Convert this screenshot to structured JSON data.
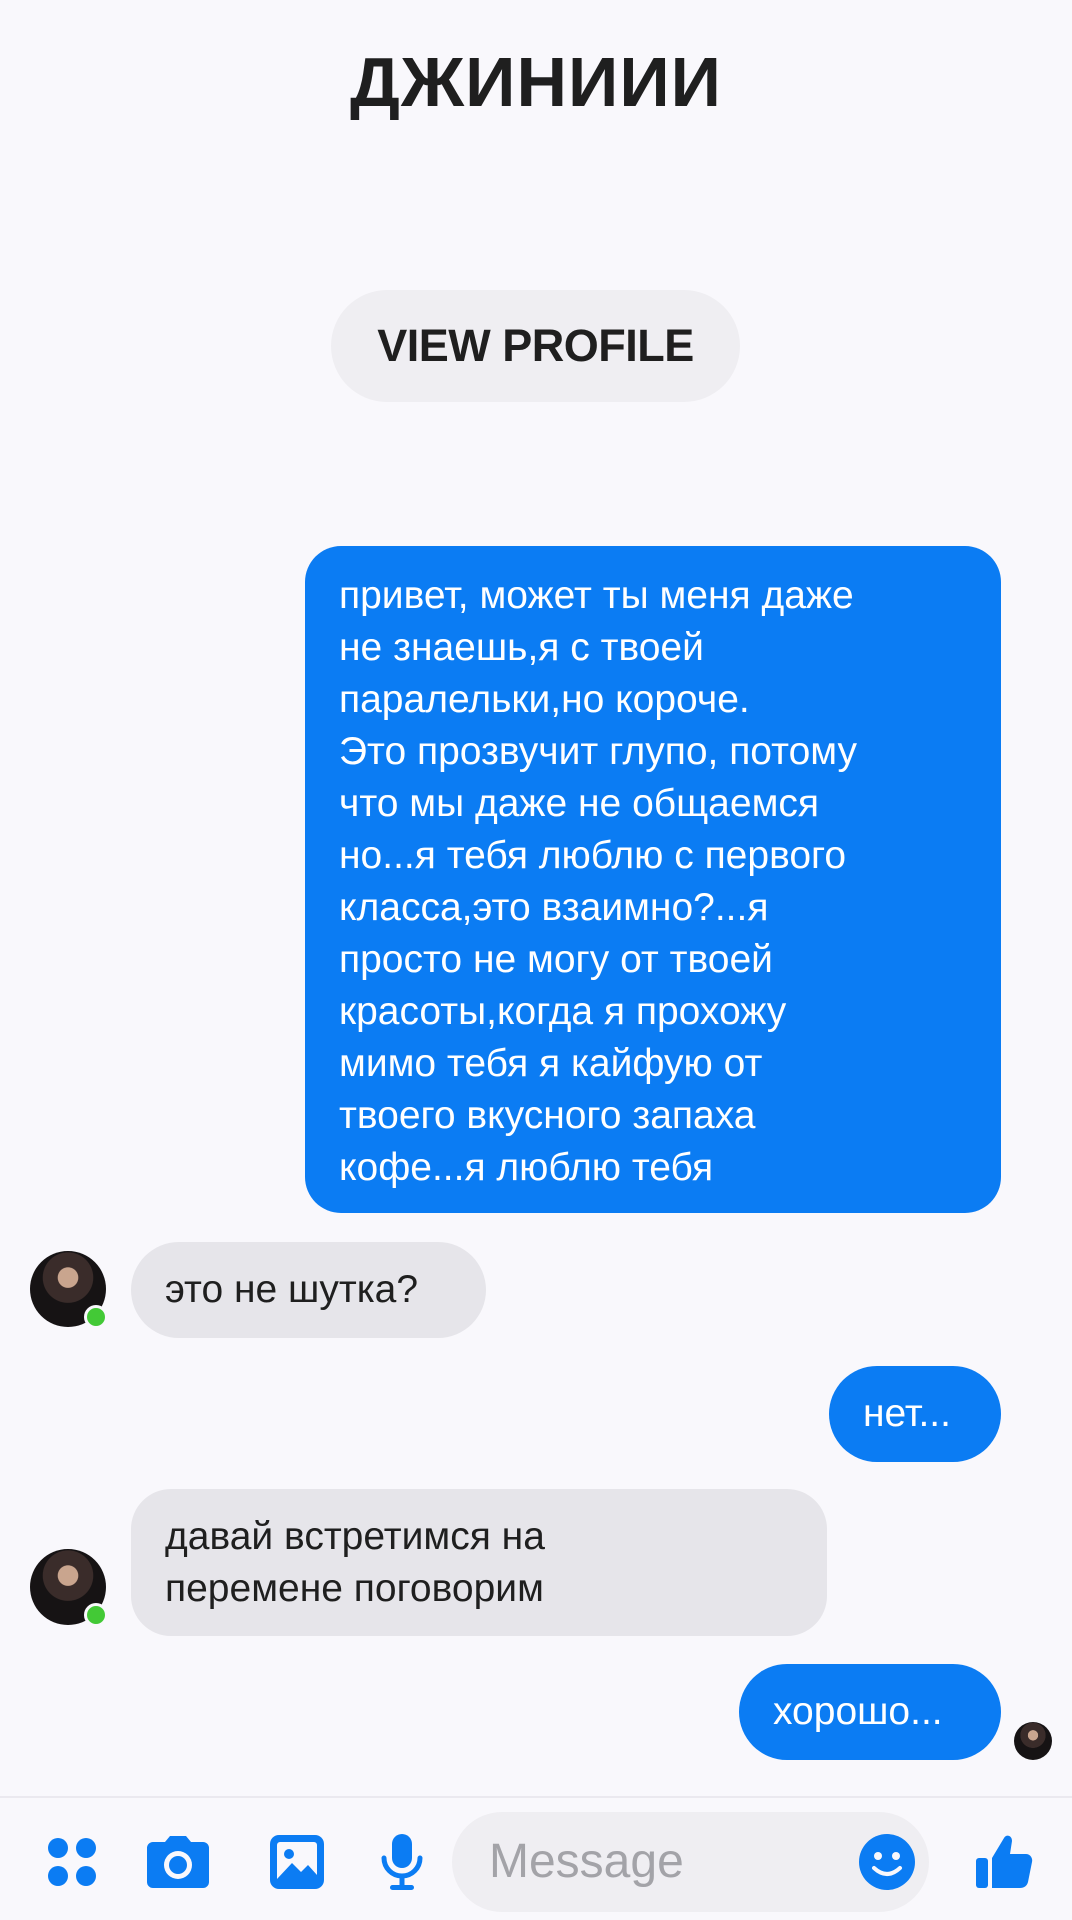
{
  "header": {
    "title": "ДЖИНИИИ"
  },
  "profile": {
    "view_profile_label": "VIEW PROFILE"
  },
  "messages": [
    {
      "direction": "outgoing",
      "lines": [
        "привет, может ты меня даже",
        "не знаешь,я с твоей",
        "паралельки,но короче.",
        "Это прозвучит глупо, потому",
        "что мы даже не общаемся",
        "но...я тебя люблю с первого",
        "класса,это взаимно?...я",
        "просто не могу от твоей",
        "красоты,когда я прохожу",
        "мимо тебя я кайфую от",
        "твоего вкусного запаха",
        "кофе...я люблю тебя"
      ]
    },
    {
      "direction": "incoming",
      "text": "это не шутка?"
    },
    {
      "direction": "outgoing",
      "text": "нет..."
    },
    {
      "direction": "incoming",
      "lines": [
        "давай встретимся на",
        "перемене поговорим"
      ]
    },
    {
      "direction": "outgoing",
      "text": "хорошо..."
    }
  ],
  "composer": {
    "placeholder": "Message",
    "icons": [
      "apps-icon",
      "camera-icon",
      "gallery-icon",
      "microphone-icon",
      "emoji-icon",
      "thumbs-up-icon"
    ]
  },
  "colors": {
    "accent": "#0b7cf3",
    "incoming_bubble": "#e6e5ea",
    "background": "#f9f8fc",
    "online_dot": "#43c936"
  }
}
